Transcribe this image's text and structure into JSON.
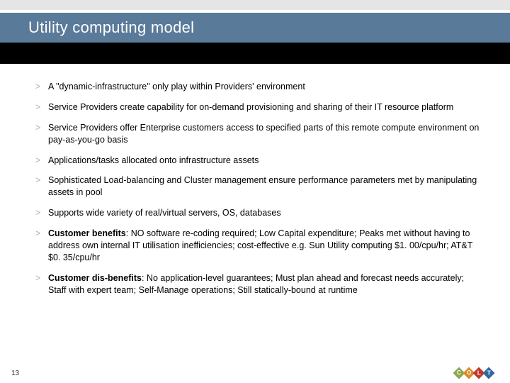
{
  "title": "Utility computing model",
  "bullets": [
    {
      "lead": "",
      "text": "A \"dynamic-infrastructure\" only play within Providers' environment"
    },
    {
      "lead": "",
      "text": "Service Providers create capability for on-demand provisioning and sharing of their IT resource platform"
    },
    {
      "lead": "",
      "text": "Service Providers offer Enterprise customers access to specified parts of this remote compute environment on pay-as-you-go basis"
    },
    {
      "lead": "",
      "text": "Applications/tasks allocated onto infrastructure assets"
    },
    {
      "lead": "",
      "text": "Sophisticated Load-balancing and Cluster management ensure performance parameters met by manipulating assets in pool"
    },
    {
      "lead": "",
      "text": "Supports wide variety of real/virtual servers, OS, databases"
    },
    {
      "lead": "Customer benefits",
      "text": ": NO software re-coding required; Low Capital expenditure; Peaks met without having to address own internal IT utilisation inefficiencies; cost-effective e.g. Sun Utility computing $1. 00/cpu/hr; AT&T $0. 35/cpu/hr"
    },
    {
      "lead": "Customer dis-benefits",
      "text": ": No application-level guarantees; Must plan ahead and forecast needs accurately; Staff with expert team; Self-Manage operations; Still statically-bound at runtime"
    }
  ],
  "pageNumber": "13",
  "logo": {
    "letters": [
      "C",
      "O",
      "L",
      "T"
    ]
  }
}
